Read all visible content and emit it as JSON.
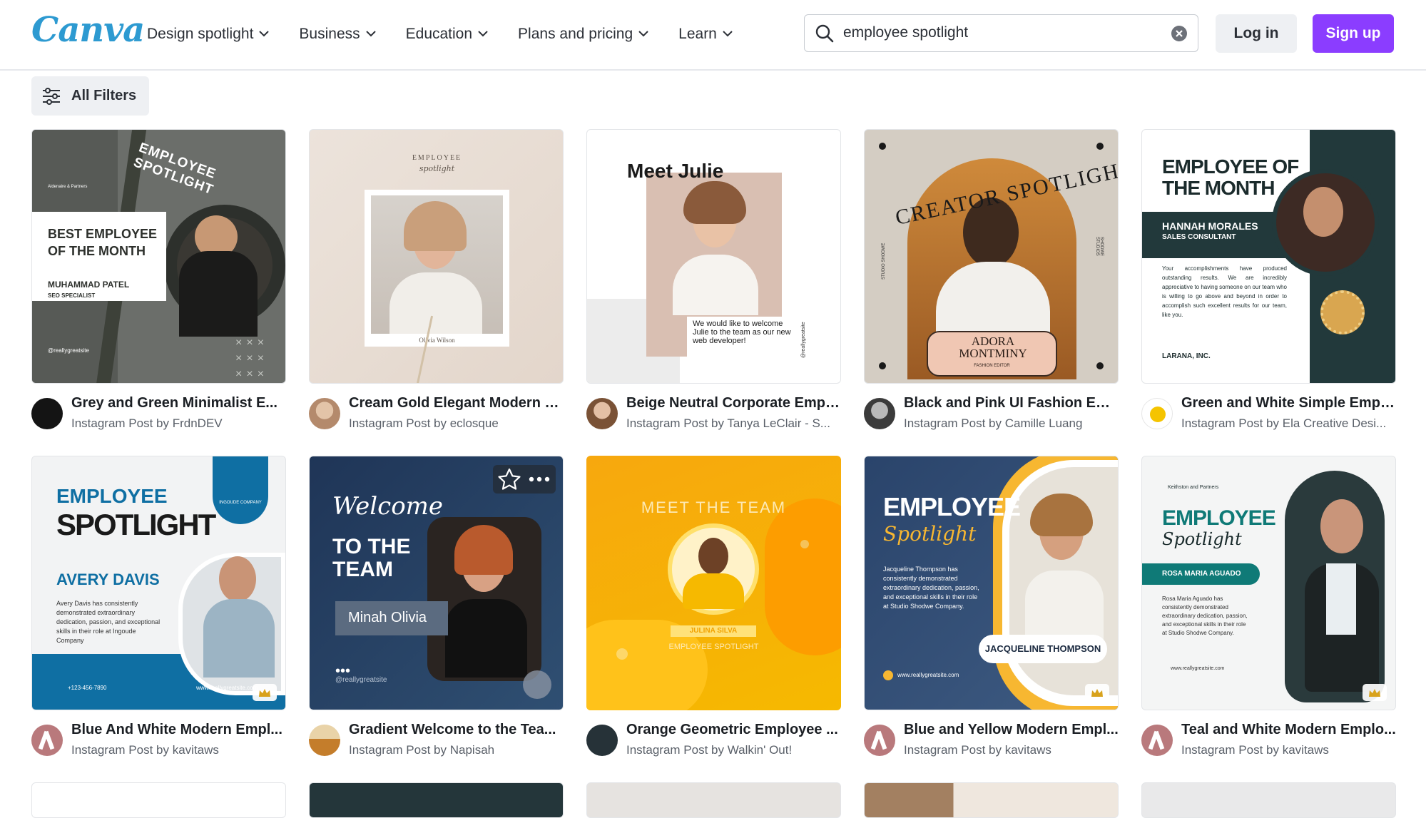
{
  "header": {
    "logo": "Canva",
    "nav": [
      {
        "label": "Design spotlight"
      },
      {
        "label": "Business"
      },
      {
        "label": "Education"
      },
      {
        "label": "Plans and pricing"
      },
      {
        "label": "Learn"
      }
    ],
    "search_value": "employee spotlight",
    "login_label": "Log in",
    "signup_label": "Sign up",
    "accent_color": "#8b3dff"
  },
  "filters": {
    "label": "All Filters"
  },
  "cards": [
    {
      "title": "Grey and Green Minimalist E...",
      "sub": "Instagram Post by FrdnDEV",
      "art": {
        "line1": "EMPLOYEE SPOTLIGHT",
        "line2": "BEST EMPLOYEE",
        "line3": "OF THE MONTH",
        "name": "MUHAMMAD PATEL",
        "role": "SEO SPECIALIST",
        "brand": "Aldenaire & Partners",
        "handle": "@reallygreatsite"
      }
    },
    {
      "title": "Cream Gold Elegant Modern E...",
      "sub": "Instagram Post by eclosque",
      "art": {
        "line1": "EMPLOYEE",
        "line2": "spotlight",
        "name": "Olivia Wilson"
      }
    },
    {
      "title": "Beige Neutral Corporate Empl...",
      "sub": "Instagram Post by Tanya LeClair - S...",
      "art": {
        "line1": "Meet Julie",
        "line2": "We would like to welcome Julie to the team as our new web developer!",
        "handle": "@reallygreatsite"
      }
    },
    {
      "title": "Black and Pink UI Fashion Edit...",
      "sub": "Instagram Post by Camille Luang",
      "art": {
        "line1": "CREATOR SPOTLIGHT",
        "name": "ADORA MONTMINY",
        "role": "FASHION EDITOR",
        "side1": "STUDIO SHODWE",
        "side2": "SHODWE STUDIOS"
      }
    },
    {
      "title": "Green and White Simple Empl...",
      "sub": "Instagram Post by Ela Creative Desi...",
      "art": {
        "line1": "EMPLOYEE OF",
        "line2": "THE MONTH",
        "name": "HANNAH MORALES",
        "role": "SALES CONSULTANT",
        "body": "Your accomplishments have produced outstanding results. We are incredibly appreciative to having someone on our team who is willing to go above and beyond in order to accomplish such excellent results for our team, like you.",
        "brand": "LARANA, INC."
      }
    },
    {
      "title": "Blue And White Modern Empl...",
      "sub": "Instagram Post by kavitaws",
      "art": {
        "line1": "EMPLOYEE",
        "line2": "SPOTLIGHT",
        "name": "AVERY DAVIS",
        "body": "Avery Davis has consistently demonstrated extraordinary dedication, passion, and exceptional skills in their role at Ingoude Company",
        "brand": "INGOUDE COMPANY",
        "phone": "+123-456-7890",
        "site": "www.reallygreatsite.com"
      }
    },
    {
      "title": "Gradient Welcome to the Tea...",
      "sub": "Instagram Post by Napisah",
      "art": {
        "line1": "Welcome",
        "line2": "TO THE",
        "line3": "TEAM",
        "name": "Minah Olivia",
        "handle": "@reallygreatsite"
      }
    },
    {
      "title": "Orange Geometric Employee ...",
      "sub": "Instagram Post by Walkin' Out!",
      "art": {
        "line1": "MEET THE TEAM",
        "name": "JULINA SILVA",
        "role": "EMPLOYEE SPOTLIGHT"
      }
    },
    {
      "title": "Blue and Yellow Modern Empl...",
      "sub": "Instagram Post by kavitaws",
      "art": {
        "line1": "EMPLOYEE",
        "line2": "Spotlight",
        "name": "JACQUELINE THOMPSON",
        "body": "Jacqueline Thompson has consistently demonstrated extraordinary dedication, passion, and exceptional skills in their role at Studio Shodwe Company.",
        "site": "www.reallygreatsite.com"
      }
    },
    {
      "title": "Teal and White Modern Emplo...",
      "sub": "Instagram Post by kavitaws",
      "art": {
        "line1": "EMPLOYEE",
        "line2": "Spotlight",
        "name": "ROSA MARIA AGUADO",
        "body": "Rosa Maria Aguado has consistently demonstrated extraordinary dedication, passion, and exceptional skills in their role at Studio Shodwe Company.",
        "brand": "Keithston and Partners",
        "site": "www.reallygreatsite.com"
      }
    }
  ]
}
